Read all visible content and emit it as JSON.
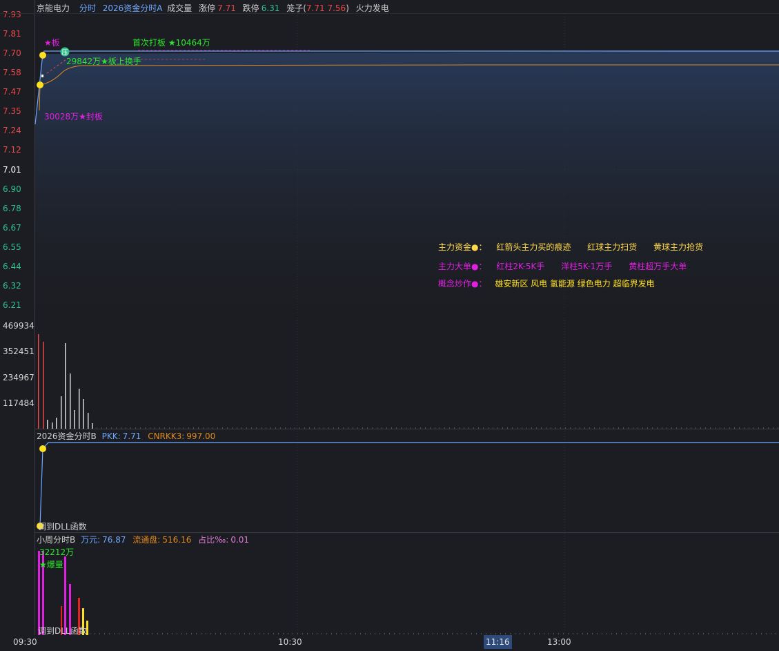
{
  "header": {
    "stock_name": "京能电力",
    "tab_name": "分时",
    "indicator_name": "2026资金分时A",
    "volume_label": "成交量",
    "limit_up_label": "涨停",
    "limit_up_value": "7.71",
    "limit_down_label": "跌停",
    "limit_down_value": "6.31",
    "cage_label": "笼子(",
    "cage_values": "7.71 7.56",
    "cage_close": ")",
    "concept": "火力发电"
  },
  "price_axis": [
    {
      "text": "7.93",
      "color": "red"
    },
    {
      "text": "7.81",
      "color": "red"
    },
    {
      "text": "7.70",
      "color": "red"
    },
    {
      "text": "7.58",
      "color": "red"
    },
    {
      "text": "7.47",
      "color": "red"
    },
    {
      "text": "7.35",
      "color": "red"
    },
    {
      "text": "7.24",
      "color": "red"
    },
    {
      "text": "7.12",
      "color": "red"
    },
    {
      "text": "7.01",
      "color": "white"
    },
    {
      "text": "6.90",
      "color": "green"
    },
    {
      "text": "6.78",
      "color": "green"
    },
    {
      "text": "6.67",
      "color": "green"
    },
    {
      "text": "6.55",
      "color": "green"
    },
    {
      "text": "6.44",
      "color": "green"
    },
    {
      "text": "6.32",
      "color": "green"
    },
    {
      "text": "6.21",
      "color": "green"
    }
  ],
  "volume_axis": [
    "469934",
    "352451",
    "234967",
    "117484"
  ],
  "annotations": {
    "board": "★板",
    "first_hit": "首次打板 ★10464万",
    "press_icon": "压",
    "turnover": "29842万★板上换手",
    "seal": "30028万★封板"
  },
  "legend": {
    "main_fund_label": "主力资金●：",
    "main_fund_items": [
      "红箭头主力买的痕迹",
      "红球主力扫货",
      "黄球主力抢货"
    ],
    "big_order_label": "主力大单●：",
    "big_order_items": [
      "红柱2K-5K手",
      "洋柱5K-1万手",
      "黄柱超万手大单"
    ],
    "concept_label": "概念炒作●：",
    "concept_items": "雄安新区 风电 氢能源 绿色电力 超临界发电"
  },
  "panel_b": {
    "title": "2026资金分时B",
    "pkk_label": "PKK:",
    "pkk_value": "7.71",
    "cnrkk_label": "CNRKK3:",
    "cnrkk_value": "997.00",
    "dll_text": "调到DLL函数"
  },
  "panel_c": {
    "title": "小周分时B",
    "wanyuan_label": "万元:",
    "wanyuan_value": "76.87",
    "float_label": "流通盘:",
    "float_value": "516.16",
    "ratio_label": "占比‰:",
    "ratio_value": "0.01",
    "burst_amount": "32212万",
    "burst_label": "★爆量",
    "dll_text": "调到DLL函数"
  },
  "time_axis": {
    "t1": "09:30",
    "t2": "10:30",
    "cursor": "11:16",
    "t3": "13:00"
  },
  "colors": {
    "background": "#1c1d22",
    "price_line": "#6fa8ff",
    "avg_line": "#e08a1e",
    "limit_red": "#e84a4a",
    "green": "#2fc08e",
    "magenta": "#e020e0",
    "yellow": "#ffe020",
    "legend_yellow": "#ffd84a"
  }
}
